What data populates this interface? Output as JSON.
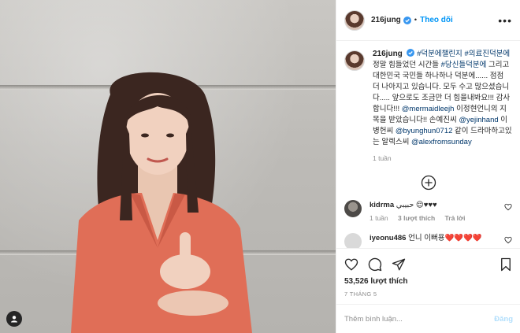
{
  "header": {
    "username": "216jung",
    "separator": "•",
    "follow_label": "Theo dõi",
    "more_icon": "more-options-icon"
  },
  "caption": {
    "username": "216jung",
    "parts": [
      {
        "type": "tag",
        "text": "#덕분에챌린지"
      },
      {
        "type": "text",
        "text": " "
      },
      {
        "type": "tag",
        "text": "#의료진덕분에"
      },
      {
        "type": "text",
        "text": " 정말 힘들었던 시간들 "
      },
      {
        "type": "tag",
        "text": "#당신들덕분에"
      },
      {
        "type": "text",
        "text": " 그리고 대한민국 국민들 하나하나 덕분에...... 점점 더 나아지고 있습니다. 모두 수고 많으셨습니다..... 앞으로도 조금만 더 힘을내봐요!!! 감사합니다!!! "
      },
      {
        "type": "tag",
        "text": "@mermaidleejh"
      },
      {
        "type": "text",
        "text": " 이정현언니의 지목을 받았습니다!! 손예진씨 "
      },
      {
        "type": "tag",
        "text": "@yejinhand"
      },
      {
        "type": "text",
        "text": " 이병헌씨 "
      },
      {
        "type": "tag",
        "text": "@byunghun0712"
      },
      {
        "type": "text",
        "text": " 같이 드라마하고있는 알렉스씨 "
      },
      {
        "type": "tag",
        "text": "@alexfromsunday"
      }
    ],
    "time": "1 tuần"
  },
  "load_more_icon": "plus-circle-icon",
  "comments": [
    {
      "username": "kidrma",
      "text": " حبيبي 😌♥♥♥",
      "time": "1 tuần",
      "likes": "3 lượt thích",
      "reply": "Trả lời",
      "avatar_color": "#6d6a66"
    },
    {
      "username": "iyeonu486",
      "text": " 언니 이뻐용❤️❤️❤️❤️",
      "time": "",
      "likes": "",
      "reply": "",
      "avatar_color": "#d9d9d9"
    }
  ],
  "actions": {
    "like_icon": "heart-icon",
    "comment_icon": "comment-icon",
    "share_icon": "share-icon",
    "save_icon": "bookmark-icon",
    "likes_text": "53,526 lượt thích",
    "date": "7 THÁNG 5"
  },
  "add_comment": {
    "placeholder": "Thêm bình luận...",
    "post_label": "Đăng"
  },
  "photo": {
    "user_tag_icon": "user-tag-icon"
  },
  "colors": {
    "link": "#00376b",
    "accent": "#0095f6",
    "muted": "#8e8e8e",
    "verified": "#3897f0",
    "post_disabled": "#b2dffc"
  }
}
